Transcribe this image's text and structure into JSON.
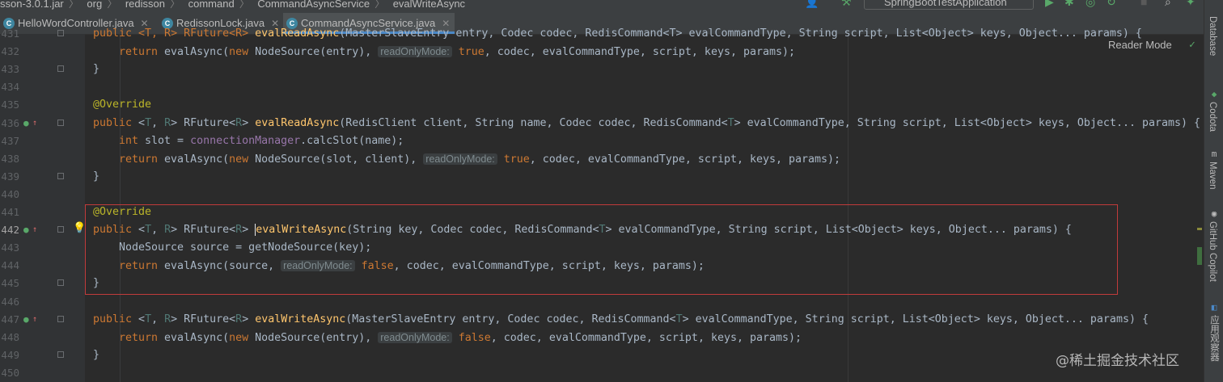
{
  "breadcrumb": [
    "sson-3.0.1.jar",
    "org",
    "redisson",
    "command",
    "CommandAsyncService",
    "evalWriteAsync"
  ],
  "run_config": "SpringBootTestApplication",
  "tabs": [
    {
      "label": "HelloWordController.java",
      "active": false
    },
    {
      "label": "RedissonLock.java",
      "active": false
    },
    {
      "label": "CommandAsyncService.java",
      "active": true
    }
  ],
  "reader_mode": "Reader Mode",
  "right_panels": [
    "Database",
    "Codota",
    "Maven",
    "GitHub Copilot",
    "应用观察器"
  ],
  "watermark": "@稀土掘金技术社区",
  "lines": [
    {
      "num": "431",
      "segments": [
        {
          "t": "public <T, R> RFuture<R> ",
          "c": "kw"
        },
        {
          "t": "evalReadAsync",
          "c": "fn"
        },
        {
          "t": "(MasterSlaveEntry entry, Codec codec, RedisCommand<T> evalCommandType, String script, List<Object> keys, Object... params) {",
          "c": ""
        }
      ]
    },
    {
      "num": "432",
      "indent": 2,
      "segments": [
        {
          "t": "return ",
          "c": "kw"
        },
        {
          "t": "evalAsync(",
          "c": ""
        },
        {
          "t": "new ",
          "c": "kw"
        },
        {
          "t": "NodeSource(entry), ",
          "c": ""
        },
        {
          "t": "readOnlyMode:",
          "c": "hint"
        },
        {
          "t": " true",
          "c": "kw"
        },
        {
          "t": ", codec, evalCommandType, script, keys, params);",
          "c": ""
        }
      ]
    },
    {
      "num": "433",
      "indent": 1,
      "segments": [
        {
          "t": "}",
          "c": ""
        }
      ]
    },
    {
      "num": "434",
      "segments": []
    },
    {
      "num": "435",
      "segments": [
        {
          "t": "@Override",
          "c": "an"
        }
      ]
    },
    {
      "num": "436",
      "segments": [
        {
          "t": "public ",
          "c": "kw"
        },
        {
          "t": "<",
          "c": ""
        },
        {
          "t": "T",
          "c": "tp"
        },
        {
          "t": ", ",
          "c": ""
        },
        {
          "t": "R",
          "c": "tp"
        },
        {
          "t": "> RFuture<",
          "c": ""
        },
        {
          "t": "R",
          "c": "tp"
        },
        {
          "t": "> ",
          "c": ""
        },
        {
          "t": "evalReadAsync",
          "c": "fn"
        },
        {
          "t": "(RedisClient client, String name, Codec codec, RedisCommand<",
          "c": ""
        },
        {
          "t": "T",
          "c": "tp"
        },
        {
          "t": "> evalCommandType, String script, List<Object> keys, Object... params) {",
          "c": ""
        }
      ]
    },
    {
      "num": "437",
      "indent": 2,
      "segments": [
        {
          "t": "int ",
          "c": "kw"
        },
        {
          "t": "slot = ",
          "c": ""
        },
        {
          "t": "connectionManager",
          "c": "fd"
        },
        {
          "t": ".calcSlot(name);",
          "c": ""
        }
      ]
    },
    {
      "num": "438",
      "indent": 2,
      "segments": [
        {
          "t": "return ",
          "c": "kw"
        },
        {
          "t": "evalAsync(",
          "c": ""
        },
        {
          "t": "new ",
          "c": "kw"
        },
        {
          "t": "NodeSource(slot, client), ",
          "c": ""
        },
        {
          "t": "readOnlyMode:",
          "c": "hint"
        },
        {
          "t": " true",
          "c": "kw"
        },
        {
          "t": ", codec, evalCommandType, script, keys, params);",
          "c": ""
        }
      ]
    },
    {
      "num": "439",
      "indent": 1,
      "segments": [
        {
          "t": "}",
          "c": ""
        }
      ]
    },
    {
      "num": "440",
      "segments": []
    },
    {
      "num": "441",
      "segments": [
        {
          "t": "@Override",
          "c": "an"
        }
      ]
    },
    {
      "num": "442",
      "segments": [
        {
          "t": "public ",
          "c": "kw"
        },
        {
          "t": "<",
          "c": ""
        },
        {
          "t": "T",
          "c": "tp"
        },
        {
          "t": ", ",
          "c": ""
        },
        {
          "t": "R",
          "c": "tp"
        },
        {
          "t": "> RFuture<",
          "c": ""
        },
        {
          "t": "R",
          "c": "tp"
        },
        {
          "t": "> ",
          "c": ""
        },
        {
          "t": "evalWriteAsync",
          "c": "fn"
        },
        {
          "t": "(String key, Codec codec, RedisCommand<",
          "c": ""
        },
        {
          "t": "T",
          "c": "tp"
        },
        {
          "t": "> evalCommandType, String script, List<Object> keys, Object... params) {",
          "c": ""
        }
      ]
    },
    {
      "num": "443",
      "indent": 2,
      "segments": [
        {
          "t": "NodeSource source = getNodeSource(key);",
          "c": ""
        }
      ]
    },
    {
      "num": "444",
      "indent": 2,
      "segments": [
        {
          "t": "return ",
          "c": "kw"
        },
        {
          "t": "evalAsync(source, ",
          "c": ""
        },
        {
          "t": "readOnlyMode:",
          "c": "hint"
        },
        {
          "t": " false",
          "c": "kw"
        },
        {
          "t": ", codec, evalCommandType, script, keys, params);",
          "c": ""
        }
      ]
    },
    {
      "num": "445",
      "indent": 1,
      "segments": [
        {
          "t": "}",
          "c": ""
        }
      ]
    },
    {
      "num": "446",
      "segments": []
    },
    {
      "num": "447",
      "segments": [
        {
          "t": "public ",
          "c": "kw"
        },
        {
          "t": "<",
          "c": ""
        },
        {
          "t": "T",
          "c": "tp"
        },
        {
          "t": ", ",
          "c": ""
        },
        {
          "t": "R",
          "c": "tp"
        },
        {
          "t": "> RFuture<",
          "c": ""
        },
        {
          "t": "R",
          "c": "tp"
        },
        {
          "t": "> ",
          "c": ""
        },
        {
          "t": "evalWriteAsync",
          "c": "fn"
        },
        {
          "t": "(MasterSlaveEntry entry, Codec codec, RedisCommand<",
          "c": ""
        },
        {
          "t": "T",
          "c": "tp"
        },
        {
          "t": "> evalCommandType, String script, List<Object> keys, Object... params) {",
          "c": ""
        }
      ]
    },
    {
      "num": "448",
      "indent": 2,
      "segments": [
        {
          "t": "return ",
          "c": "kw"
        },
        {
          "t": "evalAsync(",
          "c": ""
        },
        {
          "t": "new ",
          "c": "kw"
        },
        {
          "t": "NodeSource(entry), ",
          "c": ""
        },
        {
          "t": "readOnlyMode:",
          "c": "hint"
        },
        {
          "t": " false",
          "c": "kw"
        },
        {
          "t": ", codec, evalCommandType, script, keys, params);",
          "c": ""
        }
      ]
    },
    {
      "num": "449",
      "indent": 1,
      "segments": [
        {
          "t": "}",
          "c": ""
        }
      ]
    },
    {
      "num": "450",
      "segments": []
    }
  ]
}
